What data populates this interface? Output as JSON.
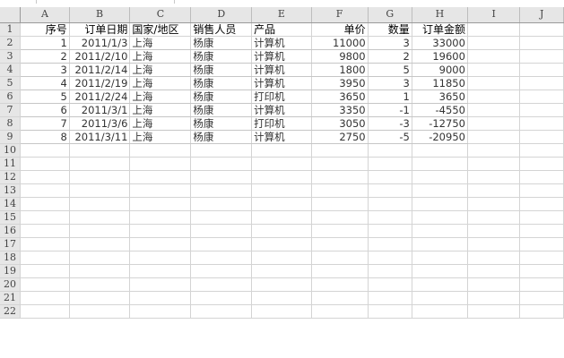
{
  "columns": [
    "A",
    "B",
    "C",
    "D",
    "E",
    "F",
    "G",
    "H",
    "I",
    "J"
  ],
  "row_numbers": [
    "1",
    "2",
    "3",
    "4",
    "5",
    "6",
    "7",
    "8",
    "9",
    "10",
    "11",
    "12",
    "13",
    "14",
    "15",
    "16",
    "17",
    "18",
    "19",
    "20",
    "21",
    "22"
  ],
  "table": {
    "headers": [
      "序号",
      "订单日期",
      "国家/地区",
      "销售人员",
      "产品",
      "单价",
      "数量",
      "订单金额"
    ],
    "rows": [
      [
        "1",
        "2011/1/3",
        "上海",
        "杨康",
        "计算机",
        "11000",
        "3",
        "33000"
      ],
      [
        "2",
        "2011/2/10",
        "上海",
        "杨康",
        "计算机",
        "9800",
        "2",
        "19600"
      ],
      [
        "3",
        "2011/2/14",
        "上海",
        "杨康",
        "计算机",
        "1800",
        "5",
        "9000"
      ],
      [
        "4",
        "2011/2/19",
        "上海",
        "杨康",
        "计算机",
        "3950",
        "3",
        "11850"
      ],
      [
        "5",
        "2011/2/24",
        "上海",
        "杨康",
        "打印机",
        "3650",
        "1",
        "3650"
      ],
      [
        "6",
        "2011/3/1",
        "上海",
        "杨康",
        "计算机",
        "3350",
        "-1",
        "-4550"
      ],
      [
        "7",
        "2011/3/6",
        "上海",
        "杨康",
        "打印机",
        "3050",
        "-3",
        "-12750"
      ],
      [
        "8",
        "2011/3/11",
        "上海",
        "杨康",
        "计算机",
        "2750",
        "-5",
        "-20950"
      ]
    ]
  }
}
